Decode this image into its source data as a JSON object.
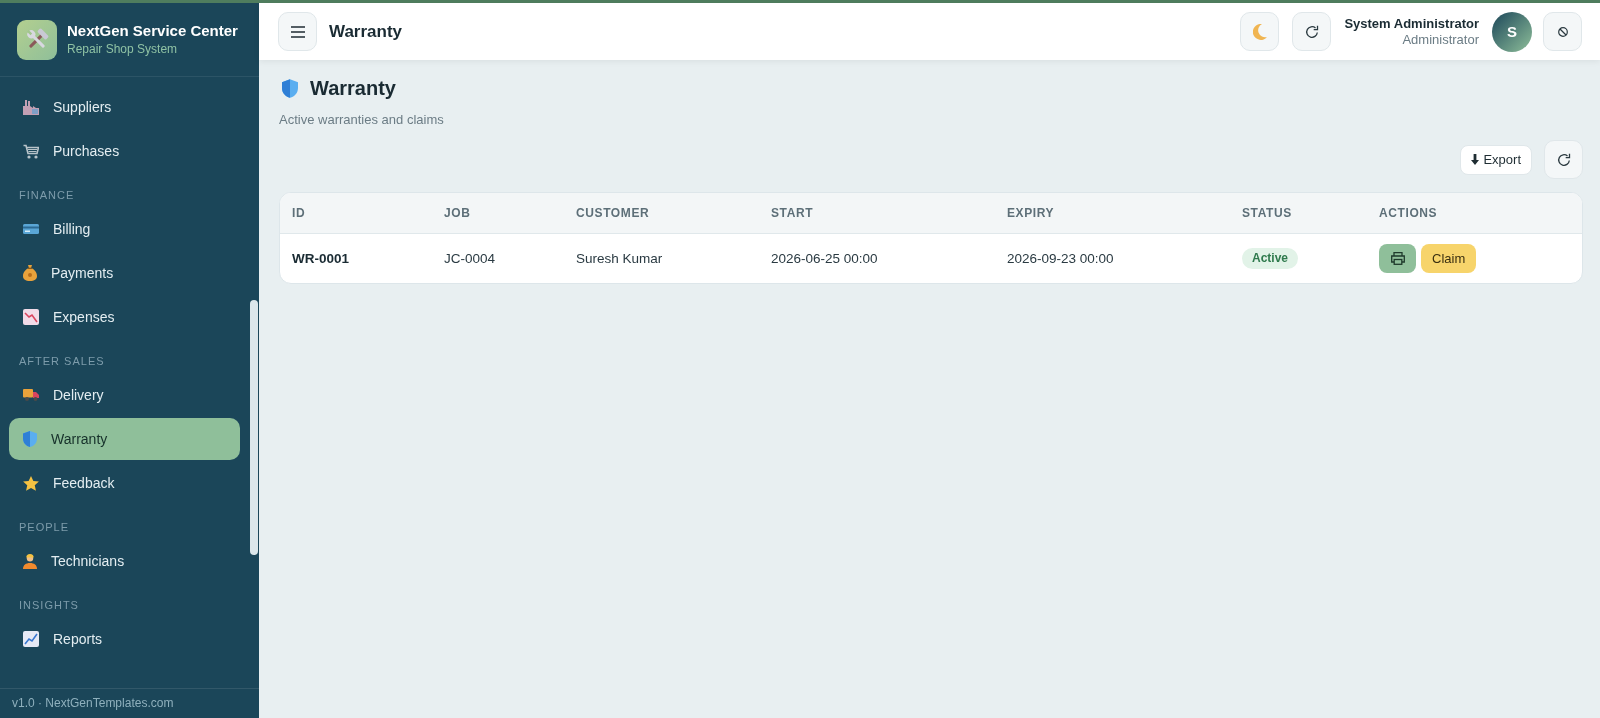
{
  "sidebar": {
    "brand": {
      "title": "NextGen Service Center",
      "subtitle": "Repair Shop System"
    },
    "sections": [
      {
        "items": [
          {
            "label": "Suppliers",
            "selected": false
          },
          {
            "label": "Purchases",
            "selected": false
          }
        ]
      },
      {
        "label": "FINANCE",
        "items": [
          {
            "label": "Billing",
            "selected": false
          },
          {
            "label": "Payments",
            "selected": false
          },
          {
            "label": "Expenses",
            "selected": false
          }
        ]
      },
      {
        "label": "AFTER SALES",
        "items": [
          {
            "label": "Delivery",
            "selected": false
          },
          {
            "label": "Warranty",
            "selected": true
          },
          {
            "label": "Feedback",
            "selected": false
          }
        ]
      },
      {
        "label": "PEOPLE",
        "items": [
          {
            "label": "Technicians",
            "selected": false
          }
        ]
      },
      {
        "label": "INSIGHTS",
        "items": [
          {
            "label": "Reports",
            "selected": false
          }
        ]
      }
    ],
    "footer": "v1.0 · NextGenTemplates.com"
  },
  "topbar": {
    "title": "Warranty",
    "user": {
      "name": "System Administrator",
      "role": "Administrator",
      "initial": "S"
    }
  },
  "page": {
    "title": "Warranty",
    "subtitle": "Active warranties and claims",
    "actions": [
      {
        "kind": "export",
        "label": "Export"
      },
      {
        "kind": "refresh"
      }
    ]
  },
  "table": {
    "columns": [
      "ID",
      "JOB",
      "CUSTOMER",
      "START",
      "EXPIRY",
      "STATUS",
      "ACTIONS"
    ],
    "rows": [
      {
        "id": "WR-0001",
        "job": "JC-0004",
        "customer": "Suresh Kumar",
        "start": "2026-06-25 00:00",
        "expiry": "2026-09-23 00:00",
        "status": {
          "kind": "active",
          "label": "Active"
        },
        "actions": [
          {
            "kind": "print"
          },
          {
            "kind": "claim",
            "label": "Claim"
          }
        ]
      }
    ]
  }
}
